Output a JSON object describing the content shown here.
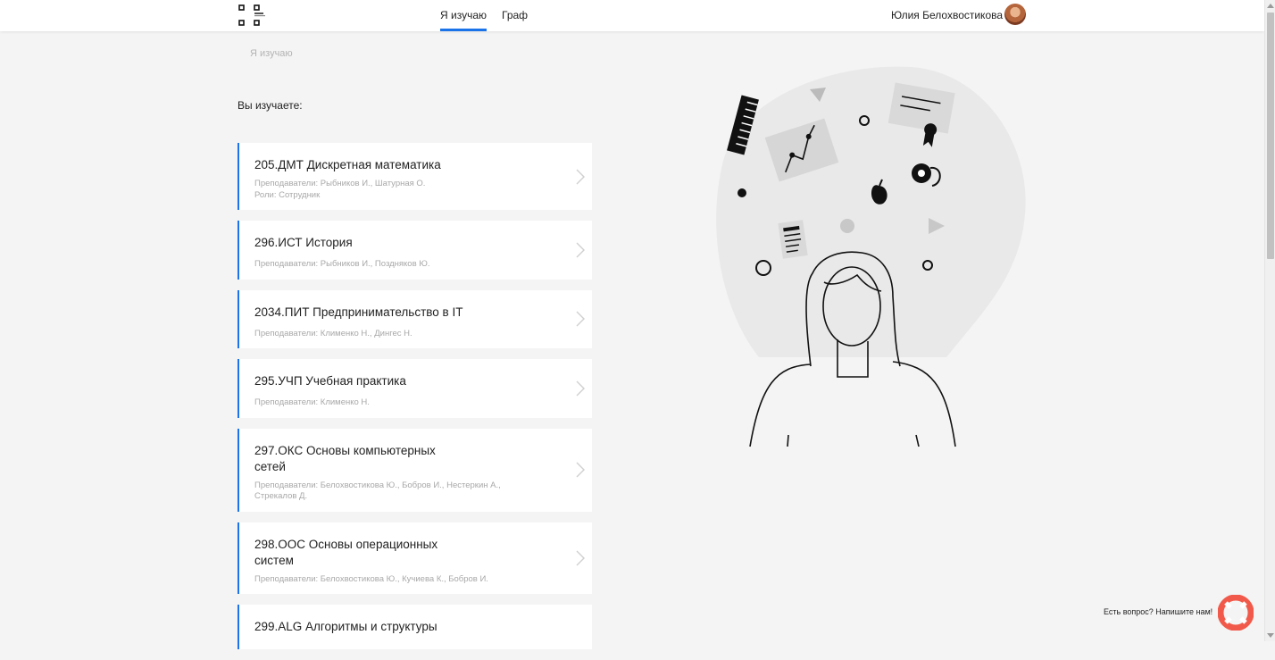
{
  "nav": {
    "tabs": [
      {
        "label": "Я изучаю",
        "active": true
      },
      {
        "label": "Граф",
        "active": false
      }
    ],
    "user_name": "Юлия Белохвостикова"
  },
  "breadcrumb": "Я изучаю",
  "section_label": "Вы изучаете:",
  "courses": [
    {
      "title": "205.ДМТ Дискретная математика",
      "teachers": "Преподаватели: Рыбников И., Шатурная О.",
      "roles": "Роли: Сотрудник"
    },
    {
      "title": "296.ИСТ История",
      "teachers": "Преподаватели: Рыбников И., Поздняков Ю."
    },
    {
      "title": "2034.ПИТ Предпринимательство в IT",
      "teachers": "Преподаватели: Клименко Н., Дингес Н."
    },
    {
      "title": "295.УЧП Учебная практика",
      "teachers": "Преподаватели: Клименко Н."
    },
    {
      "title": "297.ОКС Основы компьютерных сетей",
      "teachers": "Преподаватели: Белохвостикова Ю., Бобров И., Нестеркин А., Стрекалов Д."
    },
    {
      "title": "298.ООС Основы операционных систем",
      "teachers": "Преподаватели: Белохвостикова Ю., Кучиева К., Бобров И."
    },
    {
      "title": "299.ALG Алгоритмы и структуры",
      "teachers": ""
    }
  ],
  "help": {
    "text": "Есть вопрос? Напишите нам!"
  },
  "colors": {
    "accent": "#1a73e8",
    "background": "#f4f4f4",
    "help_button": "#f15a4a"
  }
}
